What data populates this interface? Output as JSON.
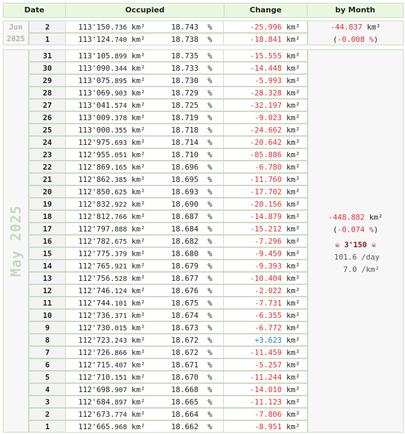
{
  "header": {
    "date": "Date",
    "occupied": "Occupied",
    "change": "Change",
    "by_month": "by Month"
  },
  "unit": "km²",
  "jun": {
    "label_month": "Jun",
    "label_year": "2025",
    "rows": [
      {
        "day": "2",
        "occ_major": "113'150.",
        "occ_minor": "736",
        "pct": "18.743",
        "chg": "-25.996",
        "sign": "neg"
      },
      {
        "day": "1",
        "occ_major": "113'124.",
        "occ_minor": "740",
        "pct": "18.738",
        "chg": "-18.841",
        "sign": "neg"
      }
    ],
    "month_change": "-44.837",
    "month_pct": "-0.008"
  },
  "may": {
    "label": "May 2025",
    "rows": [
      {
        "day": "31",
        "occ_major": "113'105.",
        "occ_minor": "899",
        "pct": "18.735",
        "chg": "-15.555",
        "sign": "neg"
      },
      {
        "day": "30",
        "occ_major": "113'090.",
        "occ_minor": "344",
        "pct": "18.733",
        "chg": "-14.448",
        "sign": "neg"
      },
      {
        "day": "29",
        "occ_major": "113'075.",
        "occ_minor": "895",
        "pct": "18.730",
        "chg": "-5.993",
        "sign": "neg"
      },
      {
        "day": "28",
        "occ_major": "113'069.",
        "occ_minor": "903",
        "pct": "18.729",
        "chg": "-28.328",
        "sign": "neg"
      },
      {
        "day": "27",
        "occ_major": "113'041.",
        "occ_minor": "574",
        "pct": "18.725",
        "chg": "-32.197",
        "sign": "neg"
      },
      {
        "day": "26",
        "occ_major": "113'009.",
        "occ_minor": "378",
        "pct": "18.719",
        "chg": "-9.023",
        "sign": "neg"
      },
      {
        "day": "25",
        "occ_major": "113'000.",
        "occ_minor": "355",
        "pct": "18.718",
        "chg": "-24.662",
        "sign": "neg"
      },
      {
        "day": "24",
        "occ_major": "112'975.",
        "occ_minor": "693",
        "pct": "18.714",
        "chg": "-20.642",
        "sign": "neg"
      },
      {
        "day": "23",
        "occ_major": "112'955.",
        "occ_minor": "051",
        "pct": "18.710",
        "chg": "-85.886",
        "sign": "neg"
      },
      {
        "day": "22",
        "occ_major": "112'869.",
        "occ_minor": "165",
        "pct": "18.696",
        "chg": "-6.780",
        "sign": "neg"
      },
      {
        "day": "21",
        "occ_major": "112'862.",
        "occ_minor": "385",
        "pct": "18.695",
        "chg": "-11.760",
        "sign": "neg"
      },
      {
        "day": "20",
        "occ_major": "112'850.",
        "occ_minor": "625",
        "pct": "18.693",
        "chg": "-17.702",
        "sign": "neg"
      },
      {
        "day": "19",
        "occ_major": "112'832.",
        "occ_minor": "922",
        "pct": "18.690",
        "chg": "-20.156",
        "sign": "neg"
      },
      {
        "day": "18",
        "occ_major": "112'812.",
        "occ_minor": "766",
        "pct": "18.687",
        "chg": "-14.879",
        "sign": "neg"
      },
      {
        "day": "17",
        "occ_major": "112'797.",
        "occ_minor": "888",
        "pct": "18.684",
        "chg": "-15.212",
        "sign": "neg"
      },
      {
        "day": "16",
        "occ_major": "112'782.",
        "occ_minor": "675",
        "pct": "18.682",
        "chg": "-7.296",
        "sign": "neg"
      },
      {
        "day": "15",
        "occ_major": "112'775.",
        "occ_minor": "379",
        "pct": "18.680",
        "chg": "-9.459",
        "sign": "neg"
      },
      {
        "day": "14",
        "occ_major": "112'765.",
        "occ_minor": "921",
        "pct": "18.679",
        "chg": "-9.393",
        "sign": "neg"
      },
      {
        "day": "13",
        "occ_major": "112'756.",
        "occ_minor": "528",
        "pct": "18.677",
        "chg": "-10.404",
        "sign": "neg"
      },
      {
        "day": "12",
        "occ_major": "112'746.",
        "occ_minor": "124",
        "pct": "18.676",
        "chg": "-2.022",
        "sign": "neg"
      },
      {
        "day": "11",
        "occ_major": "112'744.",
        "occ_minor": "101",
        "pct": "18.675",
        "chg": "-7.731",
        "sign": "neg"
      },
      {
        "day": "10",
        "occ_major": "112'736.",
        "occ_minor": "371",
        "pct": "18.674",
        "chg": "-6.355",
        "sign": "neg"
      },
      {
        "day": "9",
        "occ_major": "112'730.",
        "occ_minor": "015",
        "pct": "18.673",
        "chg": "-6.772",
        "sign": "neg"
      },
      {
        "day": "8",
        "occ_major": "112'723.",
        "occ_minor": "243",
        "pct": "18.672",
        "chg": "+3.623",
        "sign": "pos"
      },
      {
        "day": "7",
        "occ_major": "112'726.",
        "occ_minor": "866",
        "pct": "18.672",
        "chg": "-11.459",
        "sign": "neg"
      },
      {
        "day": "6",
        "occ_major": "112'715.",
        "occ_minor": "407",
        "pct": "18.671",
        "chg": "-5.257",
        "sign": "neg"
      },
      {
        "day": "5",
        "occ_major": "112'710.",
        "occ_minor": "151",
        "pct": "18.670",
        "chg": "-11.244",
        "sign": "neg"
      },
      {
        "day": "4",
        "occ_major": "112'698.",
        "occ_minor": "907",
        "pct": "18.668",
        "chg": "-14.010",
        "sign": "neg"
      },
      {
        "day": "3",
        "occ_major": "112'684.",
        "occ_minor": "897",
        "pct": "18.665",
        "chg": "-11.123",
        "sign": "neg"
      },
      {
        "day": "2",
        "occ_major": "112'673.",
        "occ_minor": "774",
        "pct": "18.664",
        "chg": "-7.806",
        "sign": "neg"
      },
      {
        "day": "1",
        "occ_major": "112'665.",
        "occ_minor": "968",
        "pct": "18.662",
        "chg": "-8.951",
        "sign": "neg"
      }
    ],
    "month_change": "-448.882",
    "month_pct": "-0.074",
    "casualties": "3'150",
    "per_day": "101.6 /day",
    "per_km": "7.0 /km²",
    "skull_icon": "skull-crossbones-icon"
  }
}
